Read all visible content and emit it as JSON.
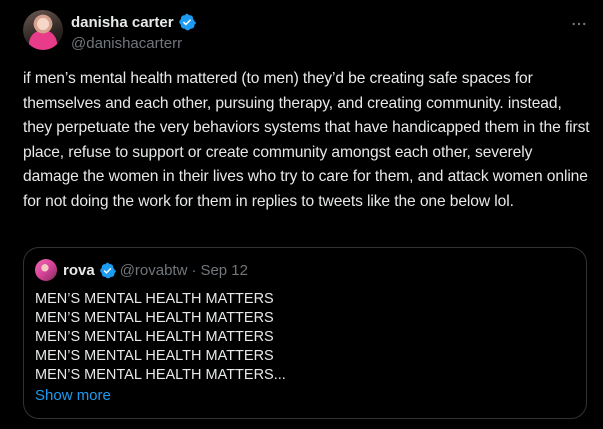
{
  "author": {
    "display_name": "danisha carter",
    "handle": "@danishacarterr"
  },
  "tweet": {
    "text": "if men’s mental health mattered (to men) they’d be creating safe spaces for themselves and each other, pursuing therapy, and creating community. instead, they perpetuate the very behaviors systems that have handicapped them in the first place, refuse to support or create community amongst each other, severely damage the women in their lives who try to care for them, and attack women online for not doing the work for them in replies to tweets like the one below lol."
  },
  "quoted": {
    "display_name": "rova",
    "handle": "@rovabtw",
    "separator": "·",
    "date": "Sep 12",
    "lines": [
      "MEN’S MENTAL HEALTH MATTERS",
      "MEN’S MENTAL HEALTH MATTERS",
      "MEN’S MENTAL HEALTH MATTERS",
      "MEN’S MENTAL HEALTH MATTERS",
      "MEN’S MENTAL HEALTH MATTERS..."
    ],
    "show_more": "Show more"
  },
  "icons": {
    "verified": "verified-badge-icon",
    "more": "more-horizontal-icon"
  },
  "colors": {
    "background": "#000000",
    "text": "#e7e9ea",
    "secondary": "#71767b",
    "accent": "#1d9bf0",
    "border": "#2f3336"
  }
}
